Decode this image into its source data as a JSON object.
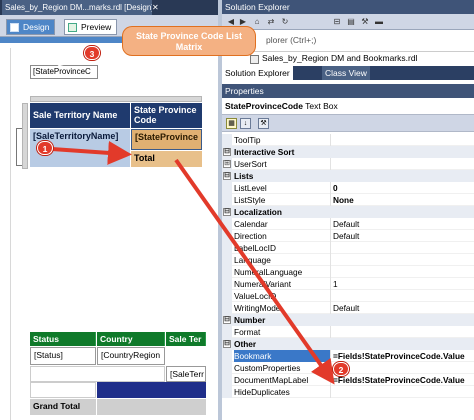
{
  "designer": {
    "doc_tab_title": "Sales_by_Region DM...marks.rdl [Design]*",
    "doc_tab_close": "✕",
    "tab_design": "Design",
    "tab_preview": "Preview",
    "parameter_box": "[StateProvinceC",
    "matrix": {
      "header_sale_territory": "Sale Territory Name",
      "header_state_province": "State Province Code",
      "cell_sale_territory": "[SaleTerritoryName]",
      "cell_state_province": "[StateProvince",
      "cell_total": "Total"
    },
    "table": {
      "header_status": "Status",
      "header_country": "Country",
      "header_sale_territory": "Sale Ter",
      "cell_status": "[Status]",
      "cell_country": "[CountryRegion",
      "cell_sale_territory": "[SaleTerr",
      "grand_total": "Grand Total"
    }
  },
  "solution_explorer": {
    "title": "Solution Explorer",
    "search_text": "plorer (Ctrl+;)",
    "tree_item": "Sales_by_Region DM and Bookmarks.rdl",
    "tab_solution_explorer": "Solution Explorer",
    "tab_class_view": "Class View"
  },
  "properties": {
    "title": "Properties",
    "object_name": "StateProvinceCode",
    "object_type": "Text Box",
    "rows": [
      {
        "kind": "prop",
        "name": "ToolTip",
        "value": ""
      },
      {
        "kind": "cat",
        "name": "Interactive Sort",
        "expander": "⊟"
      },
      {
        "kind": "prop",
        "name": "UserSort",
        "value": "",
        "expander": "⊞"
      },
      {
        "kind": "cat",
        "name": "Lists",
        "expander": "⊟"
      },
      {
        "kind": "prop",
        "name": "ListLevel",
        "value": "0",
        "bold": true
      },
      {
        "kind": "prop",
        "name": "ListStyle",
        "value": "None",
        "bold": true
      },
      {
        "kind": "cat",
        "name": "Localization",
        "expander": "⊟"
      },
      {
        "kind": "prop",
        "name": "Calendar",
        "value": "Default"
      },
      {
        "kind": "prop",
        "name": "Direction",
        "value": "Default"
      },
      {
        "kind": "prop",
        "name": "LabelLocID",
        "value": ""
      },
      {
        "kind": "prop",
        "name": "Language",
        "value": ""
      },
      {
        "kind": "prop",
        "name": "NumeralLanguage",
        "value": ""
      },
      {
        "kind": "prop",
        "name": "NumeralVariant",
        "value": "1"
      },
      {
        "kind": "prop",
        "name": "ValueLocID",
        "value": ""
      },
      {
        "kind": "prop",
        "name": "WritingMode",
        "value": "Default"
      },
      {
        "kind": "cat",
        "name": "Number",
        "expander": "⊟"
      },
      {
        "kind": "prop",
        "name": "Format",
        "value": ""
      },
      {
        "kind": "cat",
        "name": "Other",
        "expander": "⊟"
      },
      {
        "kind": "prop",
        "name": "Bookmark",
        "value": "=Fields!StateProvinceCode.Value",
        "bold": true,
        "selected": true
      },
      {
        "kind": "prop",
        "name": "CustomProperties",
        "value": ""
      },
      {
        "kind": "prop",
        "name": "DocumentMapLabel",
        "value": "=Fields!StateProvinceCode.Value",
        "bold": true
      },
      {
        "kind": "prop",
        "name": "HideDuplicates",
        "value": ""
      }
    ]
  },
  "annotations": {
    "callout_text": "State Province Code List Matrix",
    "badge_1": "1",
    "badge_2": "2",
    "badge_3": "3"
  },
  "colors": {
    "matrix_header": "#1f3a6e",
    "matrix_row_cell": "#b8cbe4",
    "matrix_col_cell": "#e0b072",
    "table_header": "#0f7a2a",
    "arrow_red": "#e23a2a",
    "callout_fill": "#f4b183"
  }
}
